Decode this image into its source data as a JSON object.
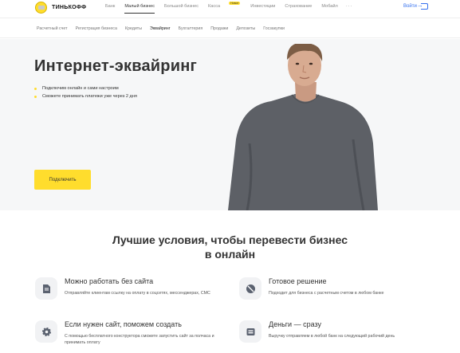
{
  "header": {
    "logo_text": "ТИНЬКОФФ",
    "nav": [
      "Банк",
      "Малый бизнес",
      "Большой бизнес",
      "Касса",
      "Инвестиции",
      "Страхование",
      "Мобайл"
    ],
    "kassa_badge": "Новое",
    "more": "···",
    "login": "Войти"
  },
  "subnav": [
    "Расчетный счет",
    "Регистрация бизнеса",
    "Кредиты",
    "Эквайринг",
    "Бухгалтерия",
    "Продажи",
    "Депозиты",
    "Госзакупки"
  ],
  "hero": {
    "title": "Интернет-эквайринг",
    "bullets": [
      "Подключим онлайн и сами настроим",
      "Сможете принимать платежи уже через 2 дня"
    ],
    "button": "Подключить"
  },
  "benefits": {
    "title_line1": "Лучшие условия, чтобы перевести бизнес",
    "title_line2": "в онлайн",
    "items": [
      {
        "title": "Можно работать без сайта",
        "desc": "Отправляйте клиентам ссылку на оплату в соцсетях, мессенджерах, СМС",
        "icon": "page-icon"
      },
      {
        "title": "Готовое решение",
        "desc": "Подходит для бизнеса с расчетным счетом в любом банке",
        "icon": "no-fee-icon"
      },
      {
        "title": "Если нужен сайт, поможем создать",
        "desc": "С помощью бесплатного конструктора сможете запустить сайт за полчаса и принимать оплату",
        "icon": "gear-icon"
      },
      {
        "title": "Деньги — сразу",
        "desc": "Выручку отправляем в любой банк на следующий рабочий день",
        "icon": "money-icon"
      }
    ]
  },
  "colors": {
    "accent": "#ffdd2d",
    "link": "#336fee",
    "hero_bg": "#f6f7f8"
  }
}
